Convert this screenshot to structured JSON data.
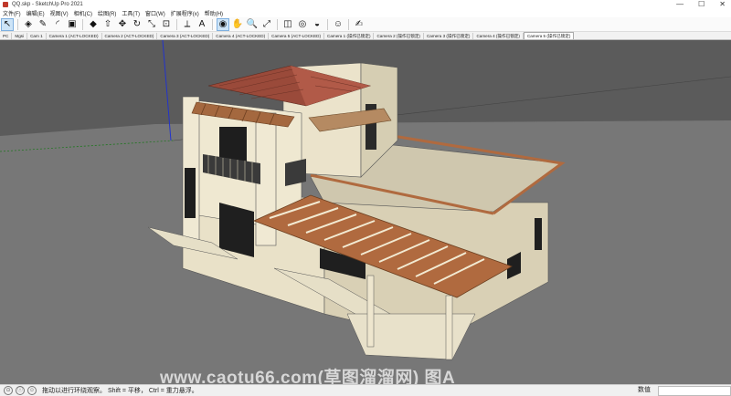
{
  "window": {
    "title": "QQ.skp - SketchUp Pro 2021",
    "minimize": "—",
    "maximize": "☐",
    "close": "✕"
  },
  "menu": [
    "文件(F)",
    "编辑(E)",
    "视图(V)",
    "相机(C)",
    "绘图(R)",
    "工具(T)",
    "窗口(W)",
    "扩展程序(x)",
    "帮助(H)"
  ],
  "toolbar": {
    "icons": [
      "select-icon",
      "eraser-icon",
      "pencil-icon",
      "arc-icon",
      "shapes-icon",
      "paint-icon",
      "push-pull-icon",
      "move-icon",
      "rotate-icon",
      "scale-icon",
      "offset-icon",
      "tape-icon",
      "text-icon",
      "orbit-icon",
      "pan-icon",
      "zoom-icon",
      "zoom-extents-icon",
      "component-icon",
      "style-icon",
      "section-icon",
      "user-icon",
      "sketch-icon"
    ],
    "glyphs": [
      "↖",
      "◈",
      "✎",
      "◜",
      "▣",
      "◆",
      "⇧",
      "✥",
      "↻",
      "⤡",
      "⊡",
      "⟂",
      "A",
      "◉",
      "✋",
      "🔍",
      "⤢",
      "◫",
      "◎",
      "◒",
      "☺",
      "✍"
    ]
  },
  "scenes": [
    "PC",
    "Mgsi",
    "Cam 1",
    "Camera 1 (ACT-LOCKED)",
    "Camera 2 (ACT-LOCKED)",
    "Camera 3 (ACT-LOCKED)",
    "Camera 4 (ACT-LOCKED)",
    "Camera 5 (ACT-LOCKED)",
    "Camera 1 (操作已锁定)",
    "Camera 2 (操作已锁定)",
    "Camera 3 (操作已锁定)",
    "Camera 4 (操作已锁定)",
    "Camera 5 (操作已锁定)"
  ],
  "active_scene": "Camera 5 (操作已锁定)",
  "status": {
    "hint": "拖动以进行环绕观察。 Shift = 平移， Ctrl = 重力悬浮。",
    "measure_label": "数值",
    "measure_value": ""
  },
  "watermark": "www.caotu66.com(草图溜溜网) 图A",
  "colors": {
    "sky": "#5b5b5b",
    "ground": "#777777",
    "wall": "#ece4cc",
    "roof_tile": "#9a4a3a",
    "pergola": "#b06a3f"
  }
}
